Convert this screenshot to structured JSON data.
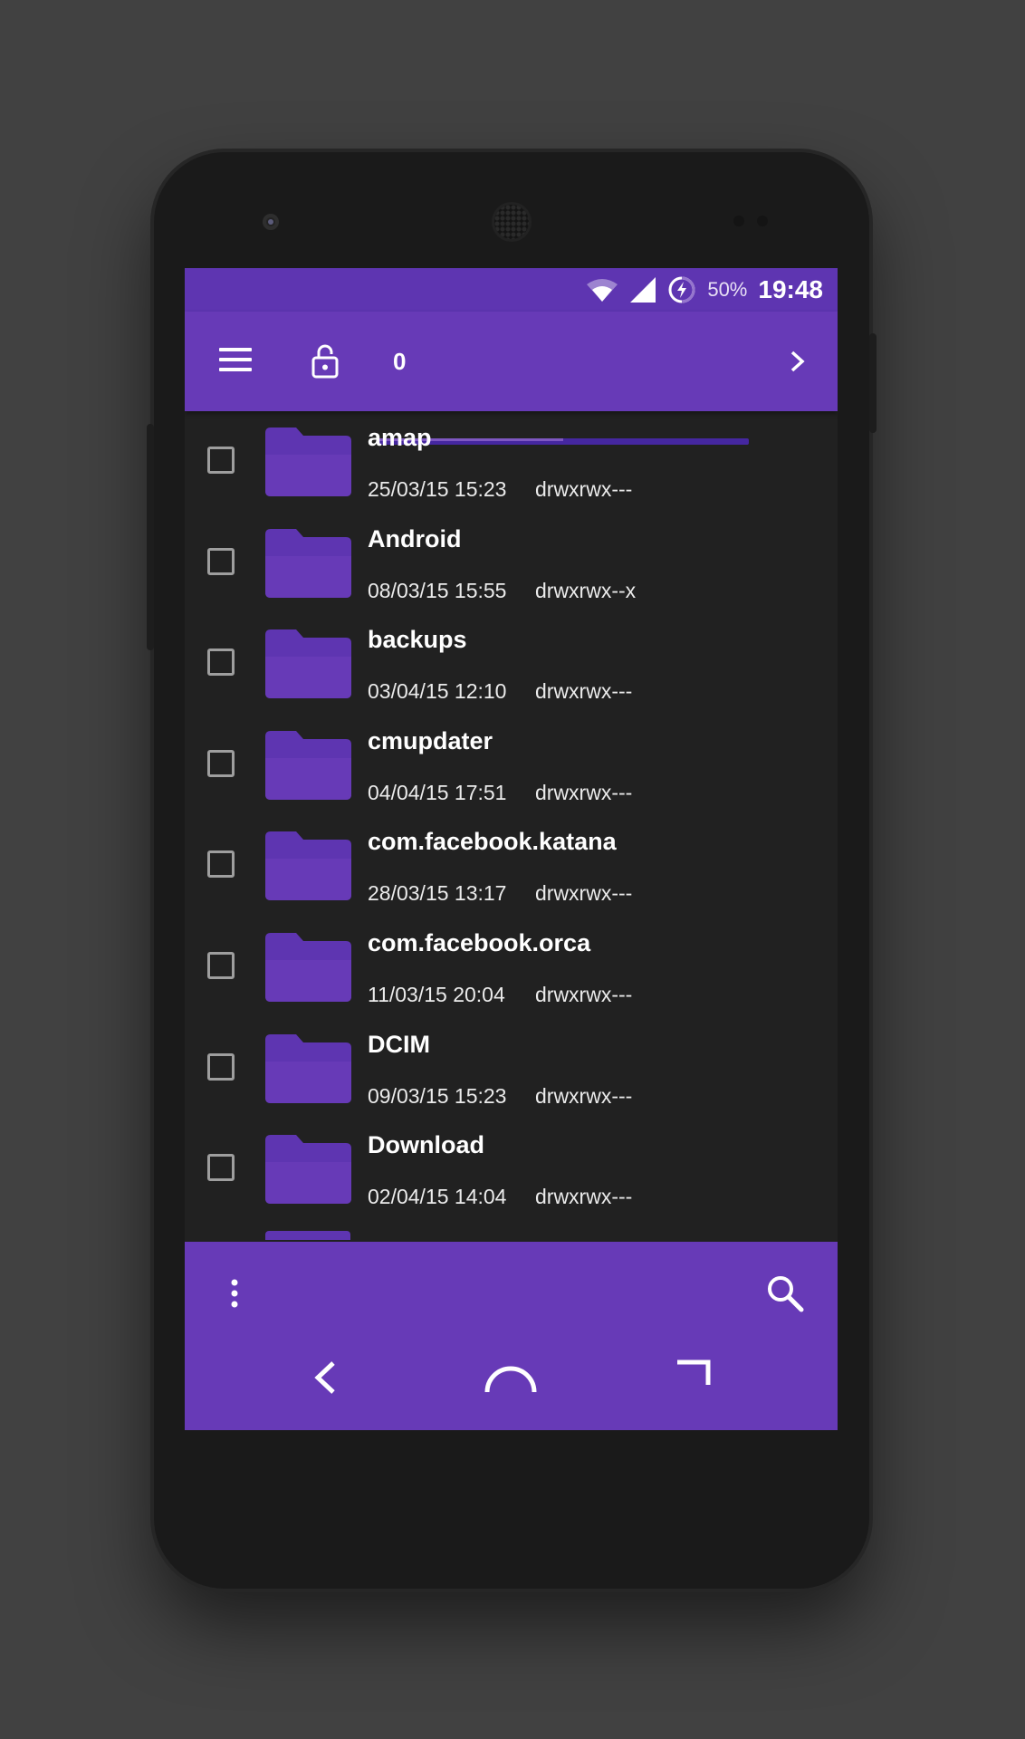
{
  "status_bar": {
    "battery": "50%",
    "time": "19:48",
    "icons": [
      "wifi-icon",
      "cell-signal-icon",
      "battery-charging-icon"
    ]
  },
  "app_bar": {
    "path_count": "0",
    "path_progress": 0.5,
    "icons": [
      "menu-icon",
      "unlock-icon",
      "chevron-right-icon"
    ]
  },
  "files": [
    {
      "name": "amap",
      "date": "25/03/15 15:23",
      "permissions": "drwxrwx---"
    },
    {
      "name": "Android",
      "date": "08/03/15 15:55",
      "permissions": "drwxrwx--x"
    },
    {
      "name": "backups",
      "date": "03/04/15 12:10",
      "permissions": "drwxrwx---"
    },
    {
      "name": "cmupdater",
      "date": "04/04/15 17:51",
      "permissions": "drwxrwx---"
    },
    {
      "name": "com.facebook.katana",
      "date": "28/03/15 13:17",
      "permissions": "drwxrwx---"
    },
    {
      "name": "com.facebook.orca",
      "date": "11/03/15 20:04",
      "permissions": "drwxrwx---"
    },
    {
      "name": "DCIM",
      "date": "09/03/15 15:23",
      "permissions": "drwxrwx---"
    },
    {
      "name": "Download",
      "date": "02/04/15 14:04",
      "permissions": "drwxrwx---"
    }
  ],
  "bottom_bar": {
    "icons": [
      "overflow-menu-icon",
      "search-icon"
    ]
  },
  "nav_bar": {
    "icons": [
      "back-icon",
      "home-icon",
      "recents-icon"
    ]
  },
  "colors": {
    "primary": "#673ab7",
    "primary_dark": "#5e35b1",
    "background": "#212121",
    "folder": "#673ab7"
  }
}
